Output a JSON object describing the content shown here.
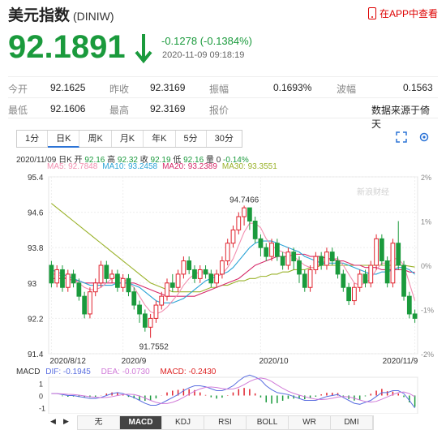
{
  "header": {
    "name": "美元指数",
    "code": "(DINIW)",
    "app_link": "在APP中查看"
  },
  "quote": {
    "price": "92.1891",
    "change": "-0.1278 (-0.1384%)",
    "time": "2020-11-09 09:18:19"
  },
  "stats": {
    "row1": [
      {
        "label": "今开",
        "value": "92.1625"
      },
      {
        "label": "昨收",
        "value": "92.3169"
      },
      {
        "label": "振幅",
        "value": "0.1693%"
      },
      {
        "label": "波幅",
        "value": "0.1563"
      }
    ],
    "row2": [
      {
        "label": "最低",
        "value": "92.1606"
      },
      {
        "label": "最高",
        "value": "92.3169"
      },
      {
        "label": "报价",
        "value": "数据来源于倚天"
      }
    ]
  },
  "tabs": [
    "1分",
    "日K",
    "周K",
    "月K",
    "年K",
    "5分",
    "30分"
  ],
  "active_tab": "日K",
  "ohlc": {
    "date": "2020/11/09",
    "period": "日K",
    "open_label": "开",
    "open": "92.16",
    "high_label": "高",
    "high": "92.32",
    "close_label": "收",
    "close": "92.19",
    "low_label": "低",
    "low": "92.16",
    "vol_label": "量",
    "vol": "0",
    "pct": "-0.14%"
  },
  "ma": [
    {
      "label": "MA5: 92.7848",
      "color": "#f28fb0"
    },
    {
      "label": "MA10: 93.2458",
      "color": "#2aa3d6"
    },
    {
      "label": "MA20: 93.2389",
      "color": "#d62a6a"
    },
    {
      "label": "MA30: 93.3551",
      "color": "#9ab22a"
    }
  ],
  "watermark": "新浪财经",
  "chart_data": {
    "type": "candlestick",
    "y_ticks": [
      "95.4",
      "94.6",
      "93.8",
      "93",
      "92.2",
      "91.4"
    ],
    "y_right_ticks": [
      "2%",
      "1%",
      "0%",
      "-1%",
      "-2%"
    ],
    "x_ticks": [
      "2020/8/12",
      "2020/9",
      "2020/10",
      "2020/11/9"
    ],
    "annotations": [
      {
        "label": "94.7466",
        "value": 94.7466
      },
      {
        "label": "91.7552",
        "value": 91.7552
      }
    ],
    "ylim": [
      91.4,
      95.4
    ],
    "candles": [
      [
        93.4,
        93.0,
        93.5,
        92.9
      ],
      [
        93.0,
        93.3,
        93.4,
        92.9
      ],
      [
        93.3,
        92.9,
        93.4,
        92.8
      ],
      [
        92.9,
        93.2,
        93.3,
        92.8
      ],
      [
        93.2,
        93.0,
        93.3,
        92.9
      ],
      [
        93.0,
        92.7,
        93.1,
        92.6
      ],
      [
        92.7,
        92.3,
        92.8,
        92.2
      ],
      [
        92.3,
        92.8,
        92.9,
        92.2
      ],
      [
        92.8,
        93.0,
        93.1,
        92.7
      ],
      [
        93.0,
        93.4,
        93.5,
        92.9
      ],
      [
        93.4,
        93.1,
        93.5,
        93.0
      ],
      [
        93.1,
        93.2,
        93.3,
        93.0
      ],
      [
        93.2,
        92.9,
        93.3,
        92.8
      ],
      [
        92.9,
        93.1,
        93.2,
        92.8
      ],
      [
        93.1,
        92.8,
        93.2,
        92.7
      ],
      [
        92.8,
        92.5,
        92.9,
        92.4
      ],
      [
        92.5,
        92.3,
        92.6,
        92.1
      ],
      [
        92.3,
        92.0,
        92.4,
        91.9
      ],
      [
        92.0,
        92.2,
        92.3,
        91.76
      ],
      [
        92.2,
        92.5,
        92.6,
        92.1
      ],
      [
        92.5,
        92.7,
        92.8,
        92.4
      ],
      [
        92.7,
        93.0,
        93.1,
        92.6
      ],
      [
        93.0,
        92.9,
        93.2,
        92.8
      ],
      [
        92.9,
        93.2,
        93.3,
        92.8
      ],
      [
        93.2,
        93.5,
        93.6,
        93.1
      ],
      [
        93.5,
        93.3,
        93.6,
        93.2
      ],
      [
        93.3,
        93.1,
        93.4,
        93.0
      ],
      [
        93.1,
        93.3,
        93.4,
        93.0
      ],
      [
        93.3,
        93.2,
        93.4,
        93.1
      ],
      [
        93.2,
        93.0,
        93.3,
        92.9
      ],
      [
        93.0,
        93.2,
        93.3,
        92.9
      ],
      [
        93.2,
        93.5,
        93.6,
        93.1
      ],
      [
        93.5,
        93.9,
        94.0,
        93.4
      ],
      [
        93.9,
        94.2,
        94.3,
        93.8
      ],
      [
        94.2,
        94.5,
        94.6,
        94.1
      ],
      [
        94.5,
        94.7,
        94.75,
        94.3
      ],
      [
        94.7,
        94.4,
        94.7,
        94.2
      ],
      [
        94.4,
        94.0,
        94.5,
        93.9
      ],
      [
        94.0,
        93.8,
        94.1,
        93.6
      ],
      [
        93.8,
        93.6,
        93.9,
        93.5
      ],
      [
        93.6,
        93.9,
        94.0,
        93.5
      ],
      [
        93.9,
        93.6,
        94.0,
        93.5
      ],
      [
        93.6,
        93.4,
        93.7,
        93.3
      ],
      [
        93.4,
        93.7,
        93.8,
        93.3
      ],
      [
        93.7,
        93.5,
        93.8,
        93.3
      ],
      [
        93.5,
        93.2,
        93.6,
        93.0
      ],
      [
        93.2,
        92.9,
        93.3,
        92.8
      ],
      [
        92.9,
        93.3,
        93.4,
        92.8
      ],
      [
        93.3,
        93.6,
        93.7,
        93.2
      ],
      [
        93.6,
        93.4,
        93.7,
        93.3
      ],
      [
        93.4,
        93.7,
        93.8,
        93.3
      ],
      [
        93.7,
        93.5,
        93.8,
        93.4
      ],
      [
        93.5,
        93.2,
        93.6,
        93.1
      ],
      [
        93.2,
        92.9,
        93.3,
        92.8
      ],
      [
        92.9,
        92.6,
        93.0,
        92.5
      ],
      [
        92.6,
        92.9,
        93.0,
        92.5
      ],
      [
        92.9,
        93.2,
        93.3,
        92.8
      ],
      [
        93.2,
        93.0,
        93.3,
        92.9
      ],
      [
        93.0,
        93.4,
        93.5,
        92.9
      ],
      [
        93.4,
        94.0,
        94.1,
        93.3
      ],
      [
        94.0,
        93.5,
        94.1,
        93.4
      ],
      [
        93.5,
        93.0,
        93.6,
        92.9
      ],
      [
        93.0,
        93.9,
        94.0,
        92.9
      ],
      [
        93.9,
        93.4,
        94.4,
        93.3
      ],
      [
        93.4,
        92.7,
        93.5,
        92.6
      ],
      [
        92.7,
        92.3,
        92.8,
        92.2
      ],
      [
        92.3,
        92.2,
        92.4,
        92.1
      ]
    ],
    "ma5": [
      93.2,
      93.2,
      93.15,
      93.1,
      93.05,
      93.0,
      92.9,
      92.85,
      92.85,
      92.9,
      93.0,
      93.1,
      93.15,
      93.1,
      93.0,
      92.9,
      92.7,
      92.5,
      92.35,
      92.3,
      92.35,
      92.45,
      92.6,
      92.75,
      92.95,
      93.1,
      93.2,
      93.25,
      93.25,
      93.2,
      93.15,
      93.2,
      93.35,
      93.55,
      93.85,
      94.15,
      94.35,
      94.35,
      94.25,
      94.0,
      93.85,
      93.75,
      93.7,
      93.65,
      93.6,
      93.5,
      93.4,
      93.35,
      93.35,
      93.45,
      93.5,
      93.55,
      93.55,
      93.4,
      93.2,
      93.0,
      92.95,
      93.0,
      93.1,
      93.3,
      93.45,
      93.45,
      93.55,
      93.55,
      93.4,
      93.0,
      92.6
    ],
    "ma10": [
      93.3,
      93.25,
      93.2,
      93.15,
      93.1,
      93.05,
      93.0,
      92.95,
      92.95,
      92.95,
      92.95,
      92.95,
      93.0,
      93.0,
      93.0,
      92.95,
      92.9,
      92.8,
      92.7,
      92.6,
      92.55,
      92.55,
      92.55,
      92.6,
      92.65,
      92.75,
      92.85,
      92.95,
      93.05,
      93.1,
      93.15,
      93.2,
      93.25,
      93.35,
      93.5,
      93.65,
      93.8,
      93.9,
      93.95,
      93.95,
      93.95,
      93.9,
      93.85,
      93.8,
      93.75,
      93.7,
      93.6,
      93.55,
      93.5,
      93.45,
      93.45,
      93.45,
      93.45,
      93.45,
      93.4,
      93.35,
      93.3,
      93.25,
      93.2,
      93.2,
      93.25,
      93.25,
      93.3,
      93.35,
      93.35,
      93.3,
      93.2
    ],
    "ma20": [
      93.1,
      93.1,
      93.1,
      93.1,
      93.05,
      93.05,
      93.0,
      93.0,
      93.0,
      93.0,
      93.0,
      93.0,
      93.0,
      93.0,
      93.0,
      93.0,
      92.95,
      92.9,
      92.85,
      92.8,
      92.75,
      92.7,
      92.7,
      92.7,
      92.7,
      92.7,
      92.7,
      92.75,
      92.8,
      92.85,
      92.9,
      92.95,
      93.0,
      93.05,
      93.1,
      93.2,
      93.3,
      93.4,
      93.45,
      93.5,
      93.55,
      93.6,
      93.6,
      93.6,
      93.65,
      93.65,
      93.65,
      93.6,
      93.6,
      93.6,
      93.55,
      93.55,
      93.5,
      93.5,
      93.45,
      93.4,
      93.4,
      93.35,
      93.35,
      93.35,
      93.3,
      93.3,
      93.3,
      93.3,
      93.3,
      93.25,
      93.24
    ],
    "ma30": [
      94.8,
      94.7,
      94.6,
      94.5,
      94.4,
      94.3,
      94.2,
      94.1,
      94.0,
      93.9,
      93.8,
      93.7,
      93.6,
      93.5,
      93.4,
      93.3,
      93.2,
      93.1,
      93.0,
      92.95,
      92.9,
      92.85,
      92.8,
      92.8,
      92.8,
      92.8,
      92.8,
      92.8,
      92.85,
      92.9,
      92.9,
      92.95,
      92.95,
      93.0,
      93.05,
      93.05,
      93.1,
      93.1,
      93.15,
      93.15,
      93.2,
      93.2,
      93.25,
      93.25,
      93.3,
      93.3,
      93.3,
      93.35,
      93.35,
      93.4,
      93.4,
      93.4,
      93.4,
      93.4,
      93.4,
      93.4,
      93.4,
      93.4,
      93.4,
      93.4,
      93.4,
      93.4,
      93.4,
      93.4,
      93.4,
      93.38,
      93.36
    ]
  },
  "macd": {
    "label": "MACD",
    "dif": "DIF: -0.1945",
    "dea": "DEA: -0.0730",
    "macd": "MACD: -0.2430",
    "y_ticks": [
      "1",
      "0",
      "-1"
    ]
  },
  "bottom_tabs": [
    "无",
    "MACD",
    "KDJ",
    "RSI",
    "BOLL",
    "WR",
    "DMI"
  ],
  "bottom_active": "MACD",
  "nav": {
    "left": "◀",
    "right": "▶"
  }
}
